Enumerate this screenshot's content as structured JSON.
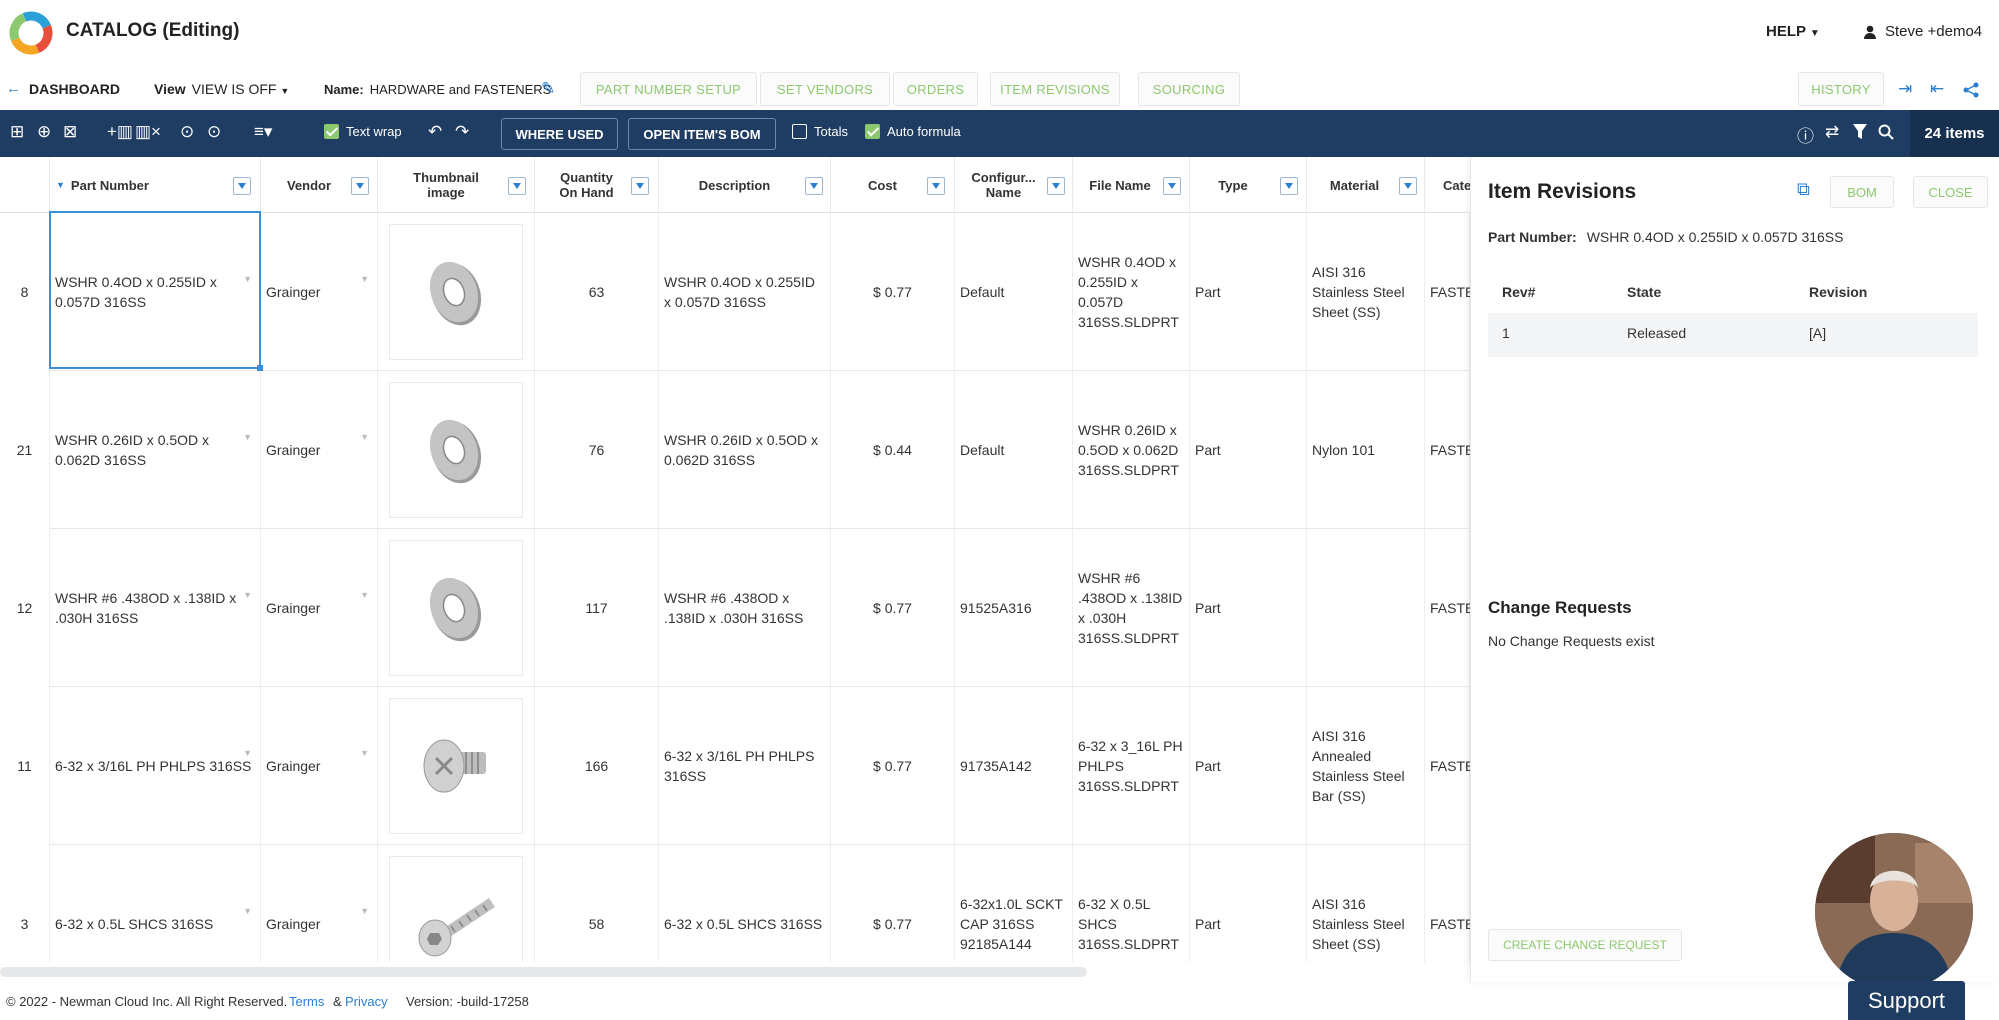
{
  "app": {
    "title": "CATALOG (Editing)",
    "help": "HELP",
    "user": "Steve +demo4"
  },
  "nav": {
    "dashboard": "DASHBOARD",
    "view_label": "View",
    "view_value": "VIEW IS OFF",
    "name_label": "Name:",
    "name_value": "HARDWARE and FASTENERS",
    "buttons": [
      "PART NUMBER SETUP",
      "SET VENDORS",
      "ORDERS",
      "ITEM REVISIONS",
      "SOURCING"
    ],
    "history": "HISTORY"
  },
  "toolbar": {
    "text_wrap": "Text wrap",
    "text_wrap_checked": true,
    "where_used": "WHERE USED",
    "open_bom": "OPEN ITEM'S BOM",
    "totals": "Totals",
    "totals_checked": false,
    "auto_formula": "Auto formula",
    "auto_formula_checked": true,
    "items_count": "24 items"
  },
  "columns": [
    "Part Number",
    "Vendor",
    "Thumbnail image",
    "Quantity On Hand",
    "Description",
    "Cost",
    "Configur... Name",
    "File Name",
    "Type",
    "Material",
    "Cate"
  ],
  "rows": [
    {
      "num": "8",
      "part": "WSHR 0.4OD x 0.255ID x 0.057D 316SS",
      "vendor": "Grainger",
      "thumb": "washer",
      "qty": "63",
      "desc": "WSHR 0.4OD x 0.255ID x 0.057D 316SS",
      "cost": "$ 0.77",
      "config": "Default",
      "file": "WSHR 0.4OD x 0.255ID x 0.057D 316SS.SLDPRT",
      "type": "Part",
      "material": "AISI 316 Stainless Steel Sheet (SS)",
      "cat": "FASTE"
    },
    {
      "num": "21",
      "part": "WSHR 0.26ID x 0.5OD x 0.062D 316SS",
      "vendor": "Grainger",
      "thumb": "washer",
      "qty": "76",
      "desc": "WSHR 0.26ID x 0.5OD x 0.062D 316SS",
      "cost": "$ 0.44",
      "config": "Default",
      "file": "WSHR 0.26ID x 0.5OD x 0.062D 316SS.SLDPRT",
      "type": "Part",
      "material": "Nylon 101",
      "cat": "FASTE"
    },
    {
      "num": "12",
      "part": "WSHR #6 .438OD x .138ID x .030H 316SS",
      "vendor": "Grainger",
      "thumb": "washer",
      "qty": "117",
      "desc": "WSHR #6 .438OD x .138ID x .030H 316SS",
      "cost": "$ 0.77",
      "config": "91525A316",
      "file": "WSHR #6 .438OD x .138ID x .030H 316SS.SLDPRT",
      "type": "Part",
      "material": "",
      "cat": "FASTE"
    },
    {
      "num": "11",
      "part": "6-32 x 3/16L PH PHLPS 316SS",
      "vendor": "Grainger",
      "thumb": "pan-screw",
      "qty": "166",
      "desc": "6-32 x 3/16L PH PHLPS 316SS",
      "cost": "$ 0.77",
      "config": "91735A142",
      "file": "6-32 x 3_16L PH PHLPS 316SS.SLDPRT",
      "type": "Part",
      "material": "AISI 316 Annealed Stainless Steel Bar (SS)",
      "cat": "FASTE"
    },
    {
      "num": "3",
      "part": "6-32 x 0.5L SHCS 316SS",
      "vendor": "Grainger",
      "thumb": "cap-screw",
      "qty": "58",
      "desc": "6-32 x 0.5L SHCS 316SS",
      "cost": "$ 0.77",
      "config": "6-32x1.0L SCKT CAP 316SS 92185A144",
      "file": "6-32 X 0.5L SHCS 316SS.SLDPRT",
      "type": "Part",
      "material": "AISI 316 Stainless Steel Sheet (SS)",
      "cat": "FASTE"
    }
  ],
  "panel": {
    "title": "Item Revisions",
    "bom": "BOM",
    "close": "CLOSE",
    "part_label": "Part Number:",
    "part_value": "WSHR 0.4OD x 0.255ID x 0.057D 316SS",
    "rev_headers": [
      "Rev#",
      "State",
      "Revision"
    ],
    "revisions": [
      {
        "rev": "1",
        "state": "Released",
        "revision": "[A]"
      }
    ],
    "cr_title": "Change Requests",
    "cr_none": "No Change Requests exist",
    "cr_button": "CREATE CHANGE REQUEST"
  },
  "footer": {
    "copyright": "© 2022 - Newman Cloud Inc. All Right Reserved.",
    "terms": "Terms",
    "amp": "&",
    "privacy": "Privacy",
    "version": "Version: -build-17258"
  },
  "support": "Support",
  "colors": {
    "accent": "#2a7fd0",
    "toolbar": "#1f3d63",
    "green": "#8cc96e"
  }
}
